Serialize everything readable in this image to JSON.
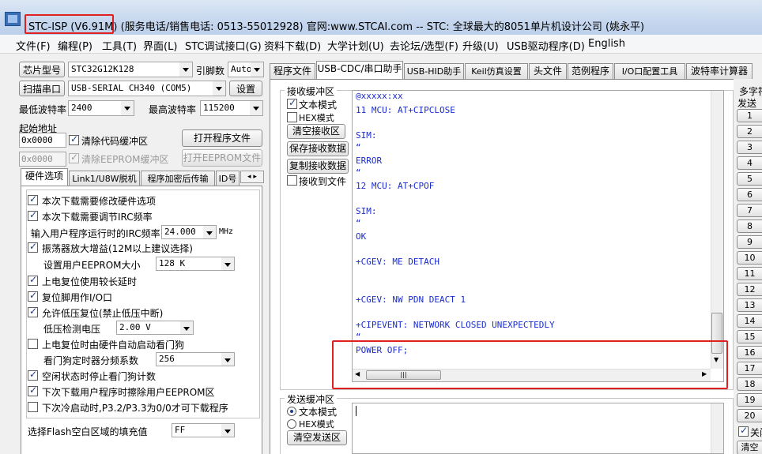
{
  "window": {
    "app_version": "STC-ISP (V6.91M)",
    "title_rest": "服务电话/销售电话: 0513-55012928) 官网:www.STCAI.com  -- STC: 全球最大的8051单片机设计公司 (姚永平)"
  },
  "menu": [
    "文件(F)",
    "编程(P)",
    "工具(T)",
    "界面(L)",
    "STC调试接口(G)",
    "资料下载(D)",
    "大学计划(U)",
    "去论坛/选型(F)",
    "升级(U)",
    "USB驱动程序(D)",
    "English"
  ],
  "left": {
    "chip_button": "芯片型号",
    "chip_value": "STC32G12K128",
    "pin_label": "引脚数",
    "pin_value": "Auto",
    "scan_button": "扫描串口",
    "port_value": "USB-SERIAL CH340 (COM5)",
    "settings_button": "设置",
    "min_baud_label": "最低波特率",
    "min_baud_value": "2400",
    "max_baud_label": "最高波特率",
    "max_baud_value": "115200",
    "start_addr_label": "起始地址",
    "addr1": "0x0000",
    "clear_code_label": "清除代码缓冲区",
    "open_program_button": "打开程序文件",
    "addr2": "0x0000",
    "clear_eeprom_label": "清除EEPROM缓冲区",
    "open_eeprom_button": "打开EEPROM文件",
    "tabs": [
      "硬件选项",
      "Link1/U8W脱机",
      "程序加密后传输",
      "ID号"
    ],
    "options": {
      "opt1": "本次下载需要修改硬件选项",
      "opt2": "本次下载需要调节IRC频率",
      "irc_label": "输入用户程序运行时的IRC频率",
      "irc_value": "24.000",
      "irc_unit": "MHz",
      "opt3": "振荡器放大增益(12M以上建议选择)",
      "eeprom_size_label": "设置用户EEPROM大小",
      "eeprom_size_value": "128   K",
      "opt4": "上电复位使用较长延时",
      "opt5": "复位脚用作I/O口",
      "opt6": "允许低压复位(禁止低压中断)",
      "lvd_label": "低压检测电压",
      "lvd_value": "2.00 V",
      "opt7": "上电复位时由硬件自动启动看门狗",
      "wdt_label": "看门狗定时器分频系数",
      "wdt_value": "256",
      "opt8": "空闲状态时停止看门狗计数",
      "opt9": "下次下载用户程序时擦除用户EEPROM区",
      "opt10": "下次冷启动时,P3.2/P3.3为0/0才可下载程序",
      "fill_label": "选择Flash空白区域的填充值",
      "fill_value": "FF"
    }
  },
  "right_tabs": [
    "程序文件",
    "USB-CDC/串口助手",
    "USB-HID助手",
    "Keil仿真设置",
    "头文件",
    "范例程序",
    "I/O口配置工具",
    "波特率计算器"
  ],
  "receive": {
    "group": "接收缓冲区",
    "text_mode": "文本模式",
    "hex_mode": "HEX模式",
    "clear": "清空接收区",
    "save": "保存接收数据",
    "copy": "复制接收数据",
    "to_file": "接收到文件",
    "lines": [
      "@xxxxx:xx",
      "11  MCU: AT+CIPCLOSE",
      "",
      "SIM:",
      "“",
      "ERROR",
      "“",
      "12  MCU: AT+CPOF",
      "",
      "SIM:",
      "“",
      "OK",
      "",
      "+CGEV: ME DETACH",
      "",
      "",
      "+CGEV: NW PDN DEACT 1",
      "",
      "+CIPEVENT: NETWORK CLOSED UNEXPECTEDLY",
      "“",
      "POWER OFF;"
    ]
  },
  "send": {
    "group": "发送缓冲区",
    "text_mode": "文本模式",
    "hex_mode": "HEX模式",
    "clear": "清空发送区"
  },
  "multi": {
    "label": "多字符",
    "send": "发送",
    "buttons": [
      "1",
      "2",
      "3",
      "4",
      "5",
      "6",
      "7",
      "8",
      "9",
      "10",
      "11",
      "12",
      "13",
      "14",
      "15",
      "16",
      "17",
      "18",
      "19",
      "20"
    ],
    "close": "关闭",
    "clear": "清空"
  }
}
